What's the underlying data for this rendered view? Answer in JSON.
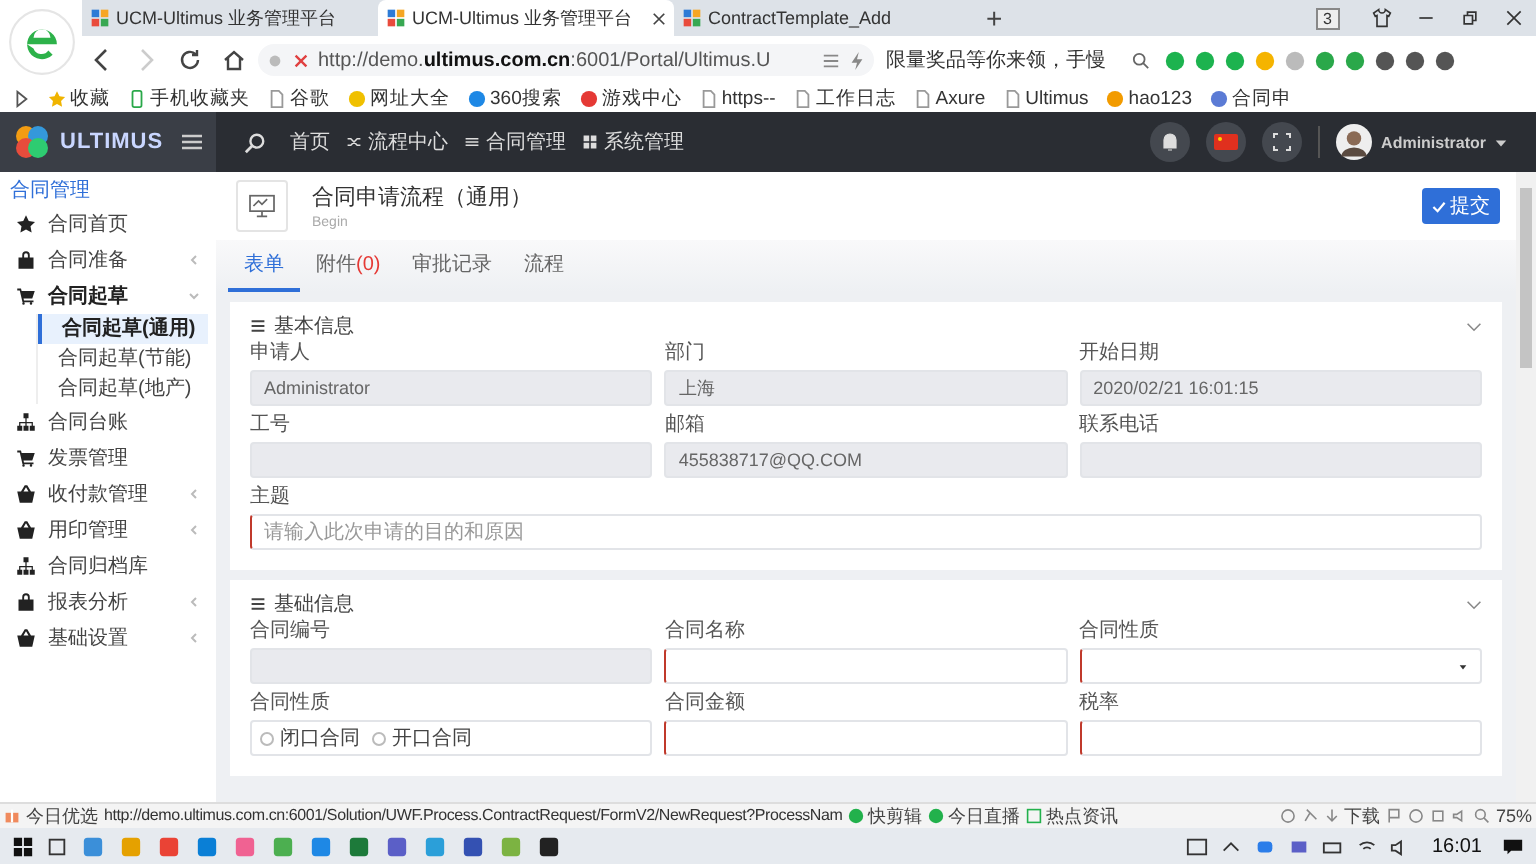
{
  "browser": {
    "tabs": [
      {
        "label": "UCM-Ultimus 业务管理平台",
        "selected": false
      },
      {
        "label": "UCM-Ultimus 业务管理平台",
        "selected": true
      },
      {
        "label": "ContractTemplate_Add",
        "selected": false
      }
    ],
    "new_tab": "+",
    "tab_count": "3",
    "address": "http://demo.**ultimus.com.cn**:6001/Portal/Ultimus.U",
    "search": {
      "placeholder": "限量奖品等你来领，手慢"
    },
    "bookmarks": [
      "收藏",
      "手机收藏夹",
      "谷歌",
      "网址大全",
      "360搜索",
      "游戏中心",
      "https--",
      "工作日志",
      "Axure",
      "Ultimus",
      "hao123",
      "合同申"
    ]
  },
  "app": {
    "logo": "ULTIMUS",
    "nav": [
      "首页",
      "流程中心",
      "合同管理",
      "系统管理"
    ],
    "user": "Administrator"
  },
  "sidebar": {
    "title": "合同管理",
    "items": [
      {
        "label": "合同首页"
      },
      {
        "label": "合同准备",
        "expanded": false
      },
      {
        "label": "合同起草",
        "expanded": true,
        "children": [
          {
            "label": "合同起草(通用)",
            "selected": true
          },
          {
            "label": "合同起草(节能)",
            "selected": false
          },
          {
            "label": "合同起草(地产)",
            "selected": false
          }
        ]
      },
      {
        "label": "合同台账"
      },
      {
        "label": "发票管理"
      },
      {
        "label": "收付款管理",
        "expanded": false
      },
      {
        "label": "用印管理",
        "expanded": false
      },
      {
        "label": "合同归档库"
      },
      {
        "label": "报表分析",
        "expanded": false
      },
      {
        "label": "基础设置",
        "expanded": false
      }
    ]
  },
  "page": {
    "title": "合同申请流程（通用）",
    "subtitle": "Begin",
    "submit": "提交",
    "tabs": [
      {
        "label": "表单",
        "selected": true
      },
      {
        "label": "附件",
        "count": "(0)",
        "selected": false
      },
      {
        "label": "审批记录",
        "selected": false
      },
      {
        "label": "流程",
        "selected": false
      }
    ],
    "cards": [
      {
        "title": "基本信息",
        "fields": [
          {
            "label": "申请人",
            "kind": "readonly",
            "value": "Administrator"
          },
          {
            "label": "部门",
            "kind": "readonly",
            "value": "上海"
          },
          {
            "label": "开始日期",
            "kind": "readonly",
            "value": "2020/02/21 16:01:15"
          },
          {
            "label": "工号",
            "kind": "readonly"
          },
          {
            "label": "邮箱",
            "kind": "readonly",
            "value": "455838717@QQ.COM"
          },
          {
            "label": "联系电话",
            "kind": "readonly"
          },
          {
            "label": "主题",
            "kind": "input",
            "wide": true,
            "required": true,
            "placeholder": "请输入此次申请的目的和原因"
          }
        ]
      },
      {
        "title": "基础信息",
        "fields": [
          {
            "label": "合同编号",
            "kind": "readonly"
          },
          {
            "label": "合同名称",
            "kind": "input",
            "required": true
          },
          {
            "label": "合同性质",
            "kind": "select",
            "required": true
          },
          {
            "label": "合同性质",
            "kind": "radio",
            "options": [
              {
                "label": "闭口合同",
                "selected": false
              },
              {
                "label": "开口合同",
                "selected": false
              }
            ]
          },
          {
            "label": "合同金额",
            "kind": "input",
            "required": true
          },
          {
            "label": "税率",
            "kind": "input",
            "required": true
          }
        ]
      }
    ]
  },
  "status_bar": {
    "label": "今日优选",
    "url": "http://demo.ultimus.com.cn:6001/Solution/UWF.Process.ContractRequest/FormV2/NewRequest?ProcessNam",
    "items": [
      "快剪辑",
      "今日直播",
      "热点资讯"
    ],
    "download": "下载",
    "zoom": "75%"
  },
  "taskbar": {
    "time": "16:01"
  }
}
